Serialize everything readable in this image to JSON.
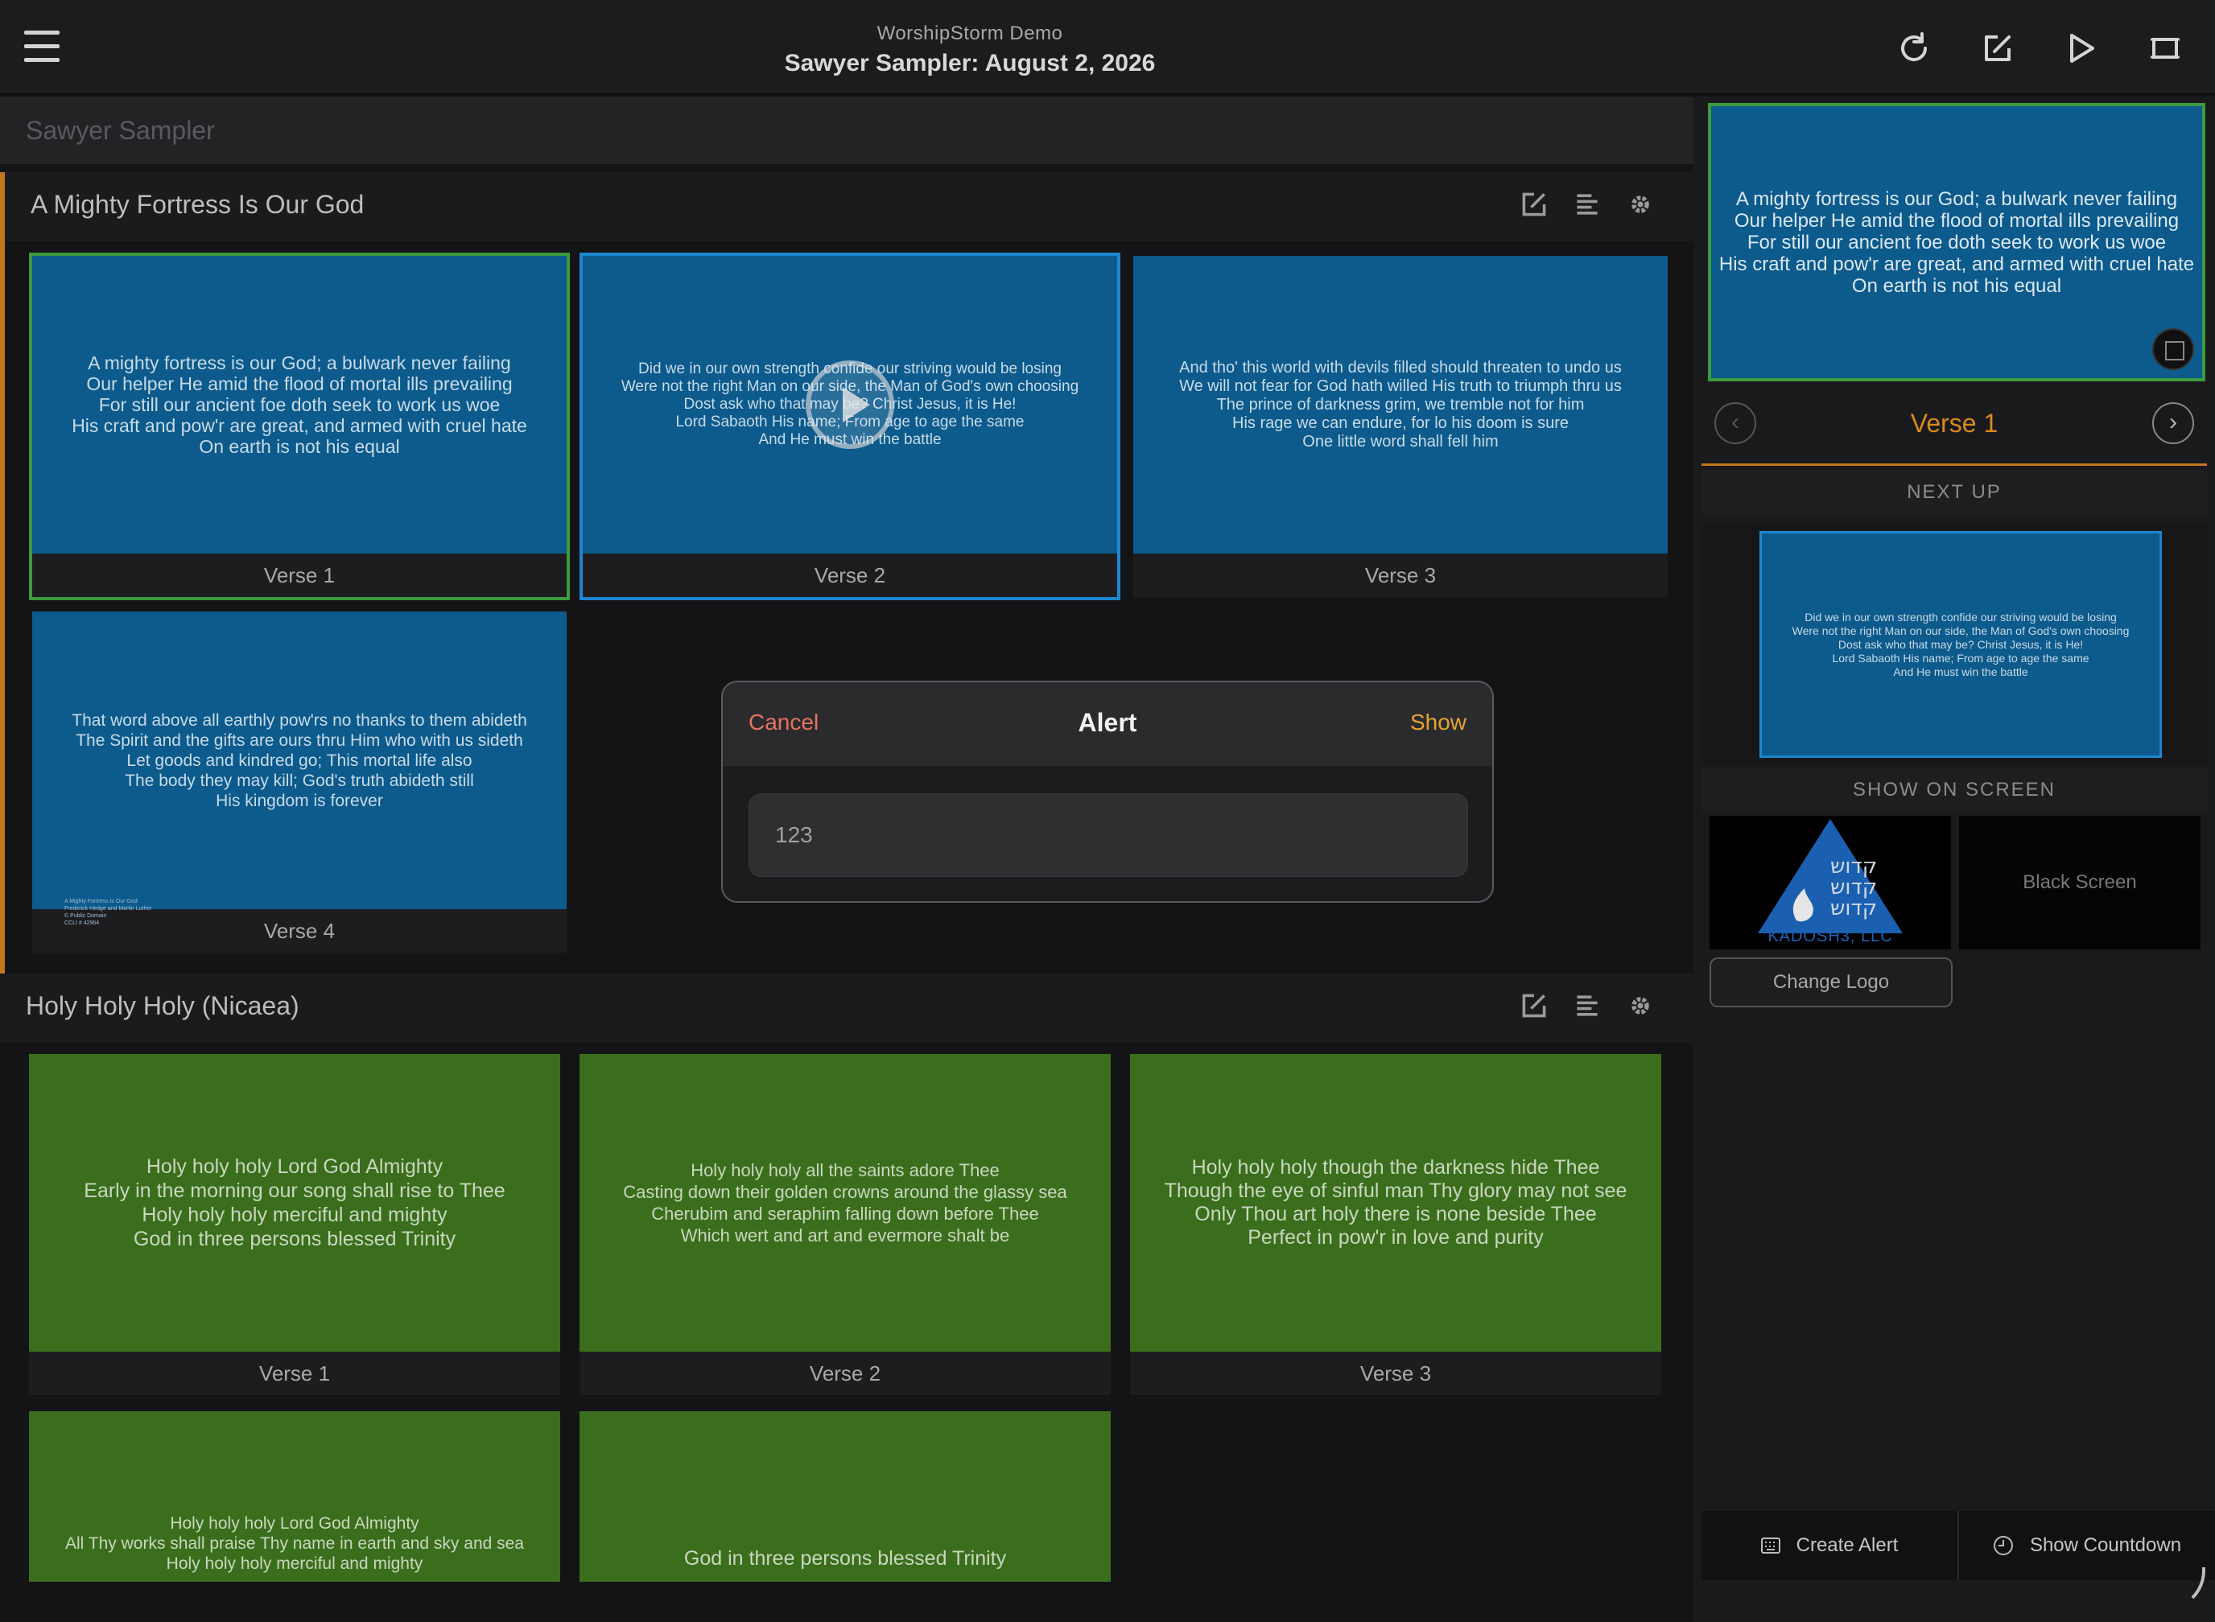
{
  "header": {
    "app_name": "WorshipStorm Demo",
    "title": "Sawyer Sampler: August 2, 2026",
    "icons": [
      "refresh-icon",
      "edit-icon",
      "play-icon",
      "screen-icon"
    ]
  },
  "set": {
    "name": "Sawyer Sampler"
  },
  "songs": [
    {
      "name": "A Mighty Fortress Is Our God",
      "color": "#0d5a8c",
      "slides": [
        {
          "label": "Verse 1",
          "text": "A mighty fortress is our God; a bulwark never failing\nOur helper He amid the flood of mortal ills prevailing\nFor still our ancient foe doth seek to work us woe\nHis craft and pow'r are great, and armed with cruel hate\nOn earth is not his equal"
        },
        {
          "label": "Verse 2",
          "text": "Did we in our own strength confide our striving would be losing\nWere not the right Man on our side, the Man of God's own choosing\nDost ask who that may be? Christ Jesus, it is He!\nLord Sabaoth His name; From age to age the same\nAnd He must win the battle"
        },
        {
          "label": "Verse 3",
          "text": "And tho' this world with devils filled should threaten to undo us\nWe will not fear for God hath willed His truth to triumph thru us\nThe prince of darkness grim, we tremble not for him\nHis rage we can endure, for lo his doom is sure\nOne little word shall fell him"
        },
        {
          "label": "Verse 4",
          "text": "That word above all earthly pow'rs no thanks to them abideth\nThe Spirit and the gifts are ours thru Him who with us sideth\nLet goods and kindred go; This mortal life also\nThe body they may kill; God's truth abideth still\nHis kingdom is forever",
          "credit": "A Mighty Fortress Is Our God\nFrederick Hedge and Martin Luther\n© Public Domain\nCCLI # 42964"
        }
      ]
    },
    {
      "name": "Holy Holy Holy (Nicaea)",
      "color": "#3b6e1c",
      "slides": [
        {
          "label": "Verse 1",
          "text": "Holy holy holy Lord God Almighty\nEarly in the morning our song shall rise to Thee\nHoly holy holy merciful and mighty\nGod in three persons blessed Trinity"
        },
        {
          "label": "Verse 2",
          "text": "Holy holy holy all the saints adore Thee\nCasting down their golden crowns around the glassy sea\nCherubim and seraphim falling down before Thee\nWhich wert and art and evermore shalt be"
        },
        {
          "label": "Verse 3",
          "text": "Holy holy holy though the darkness hide Thee\nThough the eye of sinful man Thy glory may not see\nOnly Thou art holy there is none beside Thee\nPerfect in pow'r in love and purity"
        },
        {
          "label": "",
          "text": "Holy holy holy Lord God Almighty\nAll Thy works shall praise Thy name in earth and sky and sea\nHoly holy holy merciful and mighty"
        },
        {
          "label": "",
          "text": "God in three persons blessed Trinity"
        }
      ]
    }
  ],
  "right_panel": {
    "live_text": "A mighty fortress is our God; a bulwark never failing\nOur helper He amid the flood of mortal ills prevailing\nFor still our ancient foe doth seek to work us woe\nHis craft and pow'r are great, and armed with cruel hate\nOn earth is not his equal",
    "current_verse": "Verse 1",
    "next_up_label": "NEXT UP",
    "next_text": "Did we in our own strength confide our striving would be losing\nWere not the right Man on our side, the Man of God's own choosing\nDost ask who that may be? Christ Jesus, it is He!\nLord Sabaoth His name; From age to age the same\nAnd He must win the battle",
    "show_on_screen_label": "SHOW ON SCREEN",
    "logo_caption": "KADOSH3, LLC",
    "logo_glyphs": "קדוש\nקדוש\nקדוש",
    "black_screen_label": "Black Screen",
    "change_logo_label": "Change Logo",
    "create_alert_label": "Create Alert",
    "show_countdown_label": "Show Countdown"
  },
  "modal": {
    "title": "Alert",
    "cancel_label": "Cancel",
    "show_label": "Show",
    "input_value": "123"
  },
  "colors": {
    "accent": "#c5761a",
    "selected_green": "#3d9a3d",
    "selected_blue": "#1c86d0",
    "cancel": "#e5735f",
    "show": "#e6a334"
  }
}
